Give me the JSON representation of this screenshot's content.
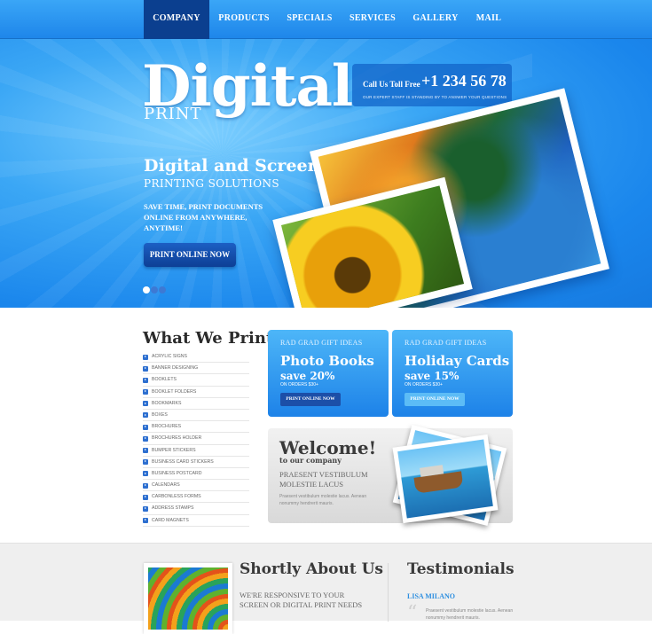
{
  "nav": {
    "items": [
      {
        "label": "COMPANY",
        "active": true
      },
      {
        "label": "PRODUCTS",
        "active": false
      },
      {
        "label": "SPECIALS",
        "active": false
      },
      {
        "label": "SERVICES",
        "active": false
      },
      {
        "label": "GALLERY",
        "active": false
      },
      {
        "label": "MAIL",
        "active": false
      }
    ]
  },
  "hero": {
    "logo_main": "Digital",
    "logo_sub": "PRINT",
    "call_label": "Call Us Toll Free",
    "call_number": "+1 234 56 78",
    "call_note": "OUR EXPERT STAFF IS STANDING BY TO ANSWER YOUR QUESTIONS",
    "headline": "Digital and Screen",
    "subheadline": "PRINTING SOLUTIONS",
    "text": "SAVE TIME, PRINT DOCUMENTS ONLINE FROM ANYWHERE, ANYTIME!",
    "button": "PRINT ONLINE NOW",
    "slides": 3,
    "active_slide": 1
  },
  "what_we_print": {
    "title": "What We Print",
    "items": [
      "ACRYLIC SIGNS",
      "BANNER DESIGNING",
      "BOOKLETS",
      "BOOKLET FOLDERS",
      "BOOKMARKS",
      "BOXES",
      "BROCHURES",
      "BROCHURES HOLDER",
      "BUMPER STICKERS",
      "BUSINESS CARD STICKERS",
      "BUSINESS POSTCARD",
      "CALENDARS",
      "CARBONLESS FORMS",
      "ADDRESS STAMPS",
      "CARD MAGNETS"
    ]
  },
  "promos": [
    {
      "tag": "RAD GRAD GIFT IDEAS",
      "title": "Photo Books",
      "save": "save 20%",
      "orders": "ON ORDERS $30+",
      "button": "PRINT ONLINE NOW",
      "button_color": "#1c5fc4"
    },
    {
      "tag": "RAD GRAD GIFT IDEAS",
      "title": "Holiday Cards",
      "save": "save 15%",
      "orders": "ON ORDERS $30+",
      "button": "PRINT ONLINE NOW",
      "button_color": "#49b0f3"
    }
  ],
  "welcome": {
    "title": "Welcome!",
    "subtitle": "to our company",
    "heading": "PRAESENT VESTIBULUM MOLESTIE LACUS",
    "text": "Praesent vestibulum molestie lacus. Aenean nonummy hendrerit mauris."
  },
  "about": {
    "title": "Shortly About Us",
    "text": "WE'RE RESPONSIVE TO YOUR SCREEN OR DIGITAL PRINT NEEDS"
  },
  "testimonials": {
    "title": "Testimonials",
    "name": "LISA MILANO",
    "text": "Praesent vestibulum molestie lacus. Aenean nonummy hendrerit mauris."
  },
  "colors": {
    "accent": "#1e86ea",
    "nav_active": "#0b3f8f"
  }
}
